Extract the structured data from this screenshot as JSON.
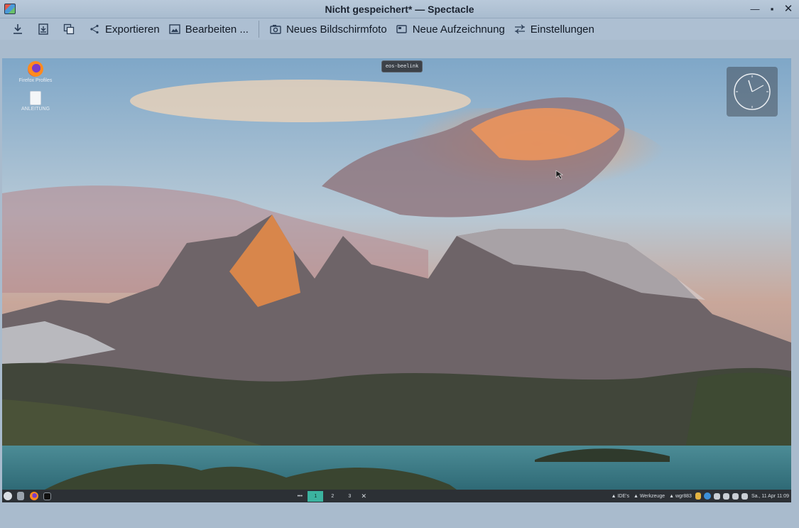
{
  "window": {
    "title": "Nicht gespeichert* — Spectacle",
    "controls": {
      "minimize": "—",
      "maximize": "▪",
      "close": "✕"
    }
  },
  "toolbar": {
    "save_icon": "download-icon",
    "save_as_icon": "save-as-icon",
    "copy_icon": "copy-icon",
    "export_label": "Exportieren",
    "edit_label": "Bearbeiten ...",
    "new_screenshot_label": "Neues Bildschirmfoto",
    "new_recording_label": "Neue Aufzeichnung",
    "settings_label": "Einstellungen"
  },
  "screenshot": {
    "host_badge": "eos-beelink",
    "desktop_icons": [
      {
        "label": "Firefox Profiles",
        "icon": "firefox-icon"
      },
      {
        "label": "ANLEITUNG",
        "icon": "file-icon"
      }
    ],
    "taskbar": {
      "dots": "•••",
      "desktops": [
        "1",
        "2",
        "3"
      ],
      "active_desktop": 0,
      "close": "✕",
      "tray_items": [
        "▲ IDE's",
        "▲ Werkzeuge",
        "▲ wgr883"
      ],
      "datetime": "Sa., 11 Apr 11:09"
    }
  },
  "colors": {
    "chrome": "#adbfd2",
    "taskbar": "#2c3035",
    "active_desktop": "#3bb3a0"
  }
}
